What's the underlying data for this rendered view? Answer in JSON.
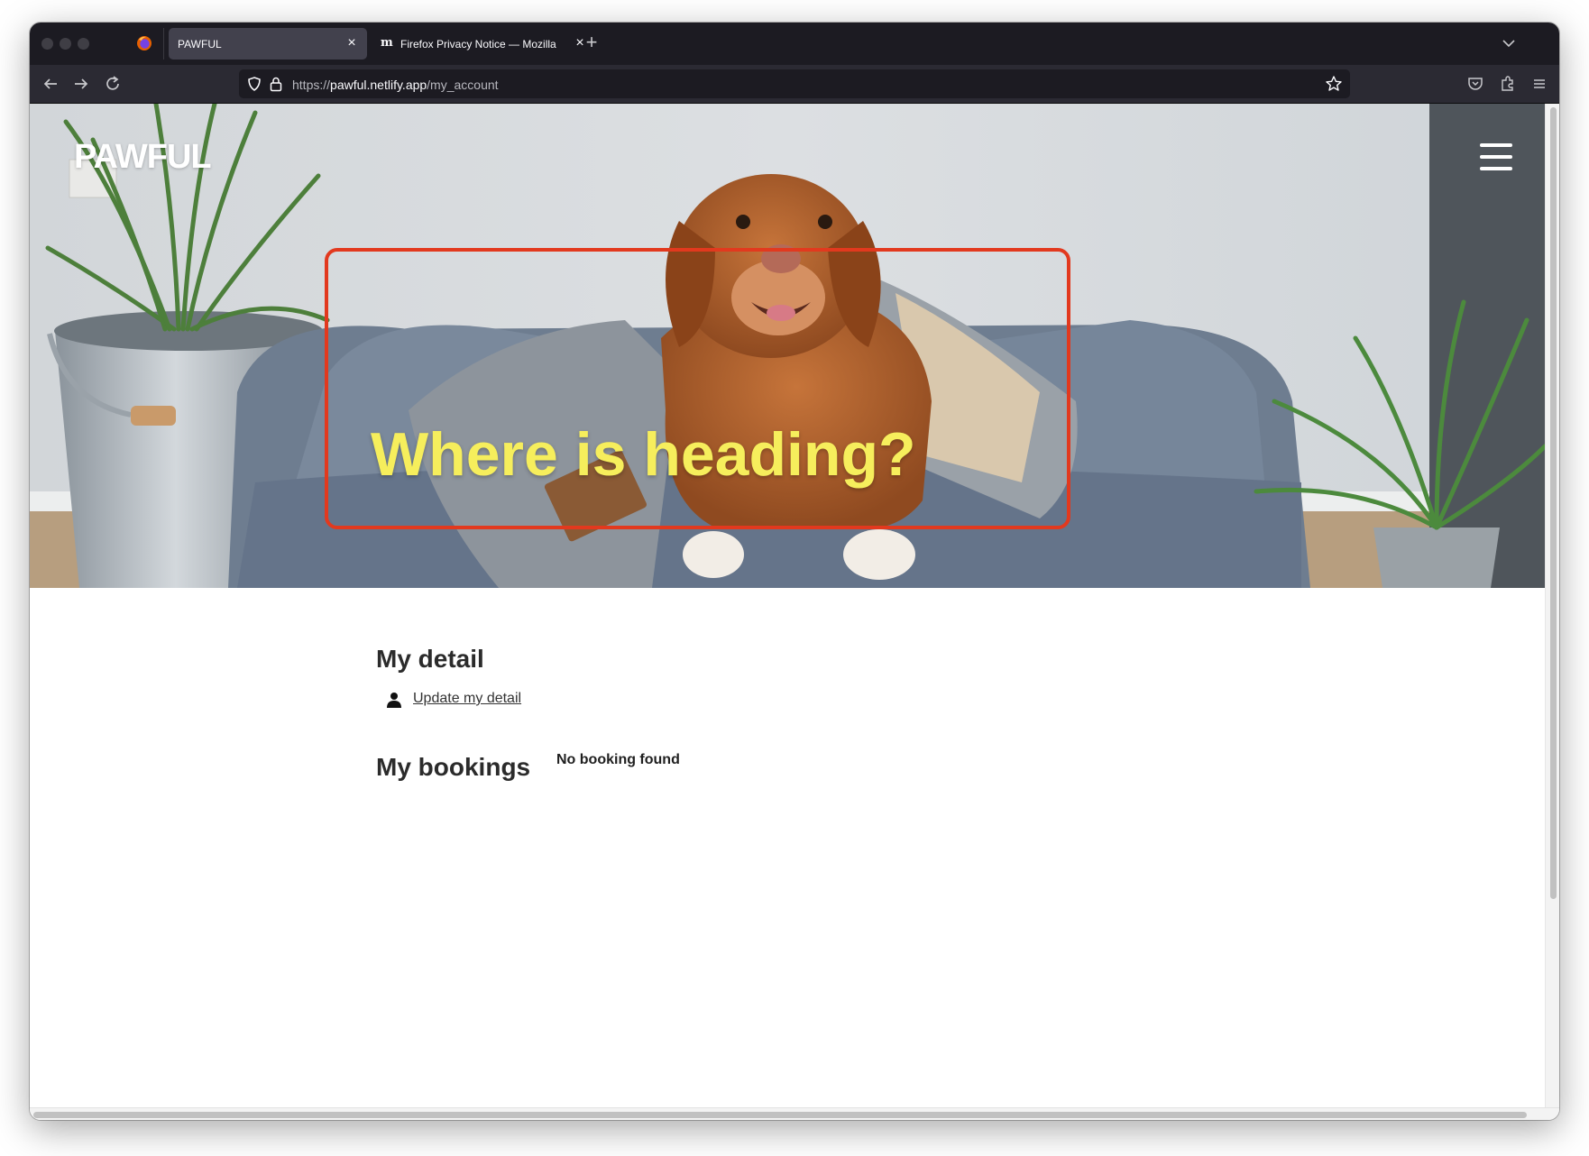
{
  "browser": {
    "tabs": [
      {
        "label": "PAWFUL",
        "active": true,
        "close_icon": "close-icon"
      },
      {
        "label": "Firefox Privacy Notice — Mozilla",
        "active": false,
        "favicon": "mozilla-icon",
        "close_icon": "close-icon"
      }
    ],
    "url": {
      "scheme": "https://",
      "host": "pawful.netlify.app",
      "path": "/my_account"
    },
    "icons": [
      "back-arrow-icon",
      "forward-arrow-icon",
      "reload-icon",
      "shield-icon",
      "lock-icon",
      "star-icon",
      "pocket-icon",
      "extensions-icon",
      "menu-icon",
      "new-tab-icon",
      "tab-list-icon",
      "firefox-icon"
    ]
  },
  "site": {
    "brand": "PAWFUL",
    "hero_heading": "Where is heading?",
    "menu_icon": "hamburger-icon",
    "callout_color": "#e2391e",
    "heading_color": "#f6ee5c"
  },
  "account": {
    "detail_title": "My detail",
    "update_link": "Update my detail",
    "update_icon": "person-icon",
    "bookings_title": "My bookings",
    "bookings_empty": "No booking found"
  }
}
